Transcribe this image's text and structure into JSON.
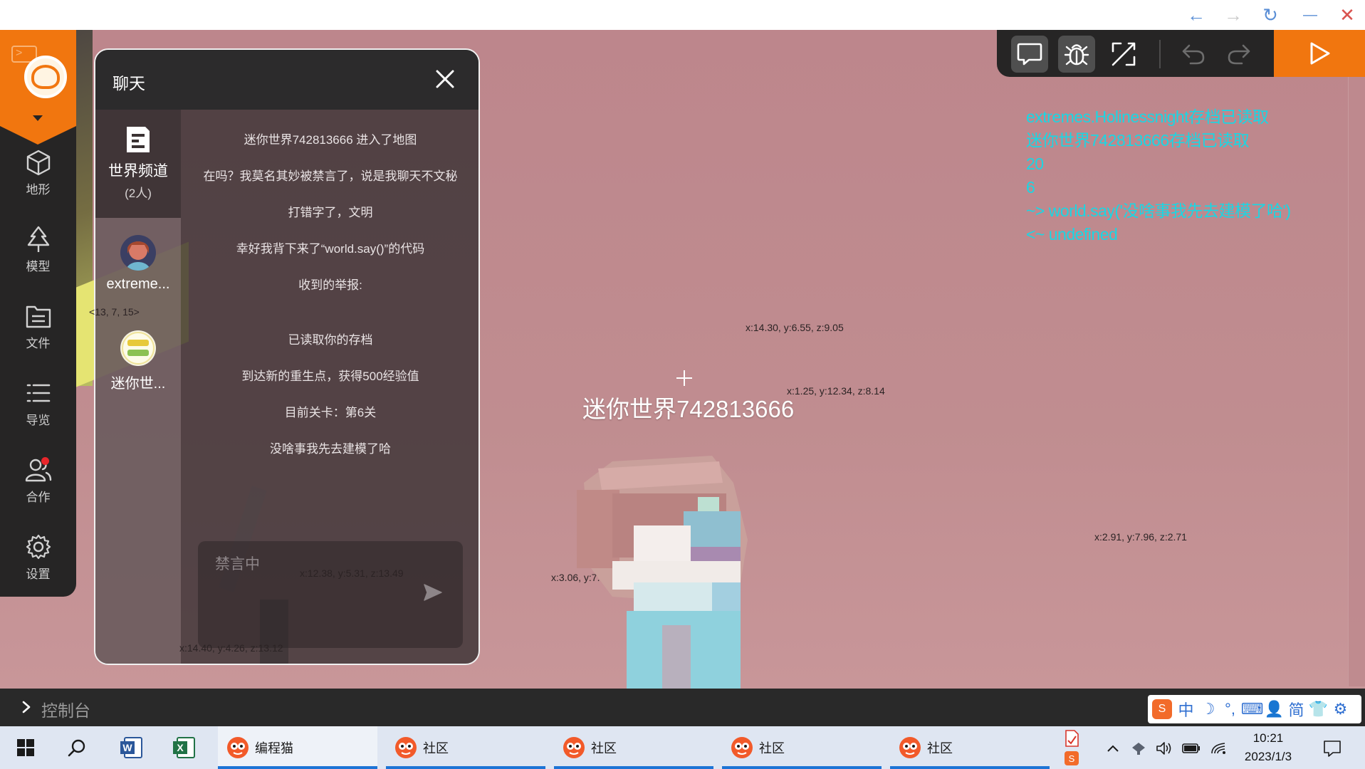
{
  "window": {
    "controls": {
      "back": "←",
      "forward": "→",
      "refresh": "↻",
      "minimize": "—",
      "close": "✕"
    }
  },
  "sidebar": {
    "items": [
      {
        "label": "地形",
        "icon": "cube-icon"
      },
      {
        "label": "模型",
        "icon": "tree-icon"
      },
      {
        "label": "文件",
        "icon": "file-list-icon"
      },
      {
        "label": "导览",
        "icon": "outline-list-icon"
      },
      {
        "label": "合作",
        "icon": "collaborate-icon",
        "badge": true
      },
      {
        "label": "设置",
        "icon": "gear-icon"
      }
    ]
  },
  "chat": {
    "title": "聊天",
    "channel": {
      "name": "世界频道",
      "count": "(2人)"
    },
    "members": [
      {
        "name": "extreme..."
      },
      {
        "name": "迷你世..."
      }
    ],
    "messages": [
      "迷你世界742813666 进入了地图",
      "在吗？我莫名其妙被禁言了，说是我聊天不文秘",
      "打错字了，文明",
      "幸好我背下来了“world.say()”的代码",
      "收到的举报:",
      "已读取你的存档",
      "到达新的重生点，获得500经验值",
      "目前关卡：第6关",
      "没啥事我先去建模了哈"
    ],
    "input_placeholder": "禁言中"
  },
  "scene": {
    "player_name": "迷你世界742813666",
    "coords": [
      "x:14.30, y:6.55, z:9.05",
      "x:1.25, y:12.34, z:8.14",
      "x:2.91, y:7.96, z:2.71",
      "x:3.06, y:7.55, z:13.38",
      "x:12.38, y:5.31, z:13.49",
      "x:14.40, y:4.26, z:13.12",
      "<13, 7, 15>"
    ]
  },
  "console": {
    "label": "控制台",
    "output": [
      "extremes.Holinessnight存档已读取",
      "迷你世界742813666存档已读取",
      "20",
      "6",
      "~> world.say('没啥事我先去建模了哈')",
      "<~ undefined"
    ]
  },
  "ime": {
    "items": [
      "中",
      "☽",
      "°,",
      "⌨",
      "👤",
      "简",
      "👕",
      "⚙"
    ]
  },
  "taskbar": {
    "apps": [
      {
        "label": "编程猫"
      },
      {
        "label": "社区"
      },
      {
        "label": "社区"
      },
      {
        "label": "社区"
      },
      {
        "label": "社区"
      }
    ],
    "clock": {
      "time": "10:21",
      "date": "2023/1/3"
    }
  },
  "colors": {
    "accent": "#f1760f",
    "console_text": "#19d7e4",
    "sidebar_bg": "#262525",
    "scene_bg": "#bd8a8e"
  }
}
